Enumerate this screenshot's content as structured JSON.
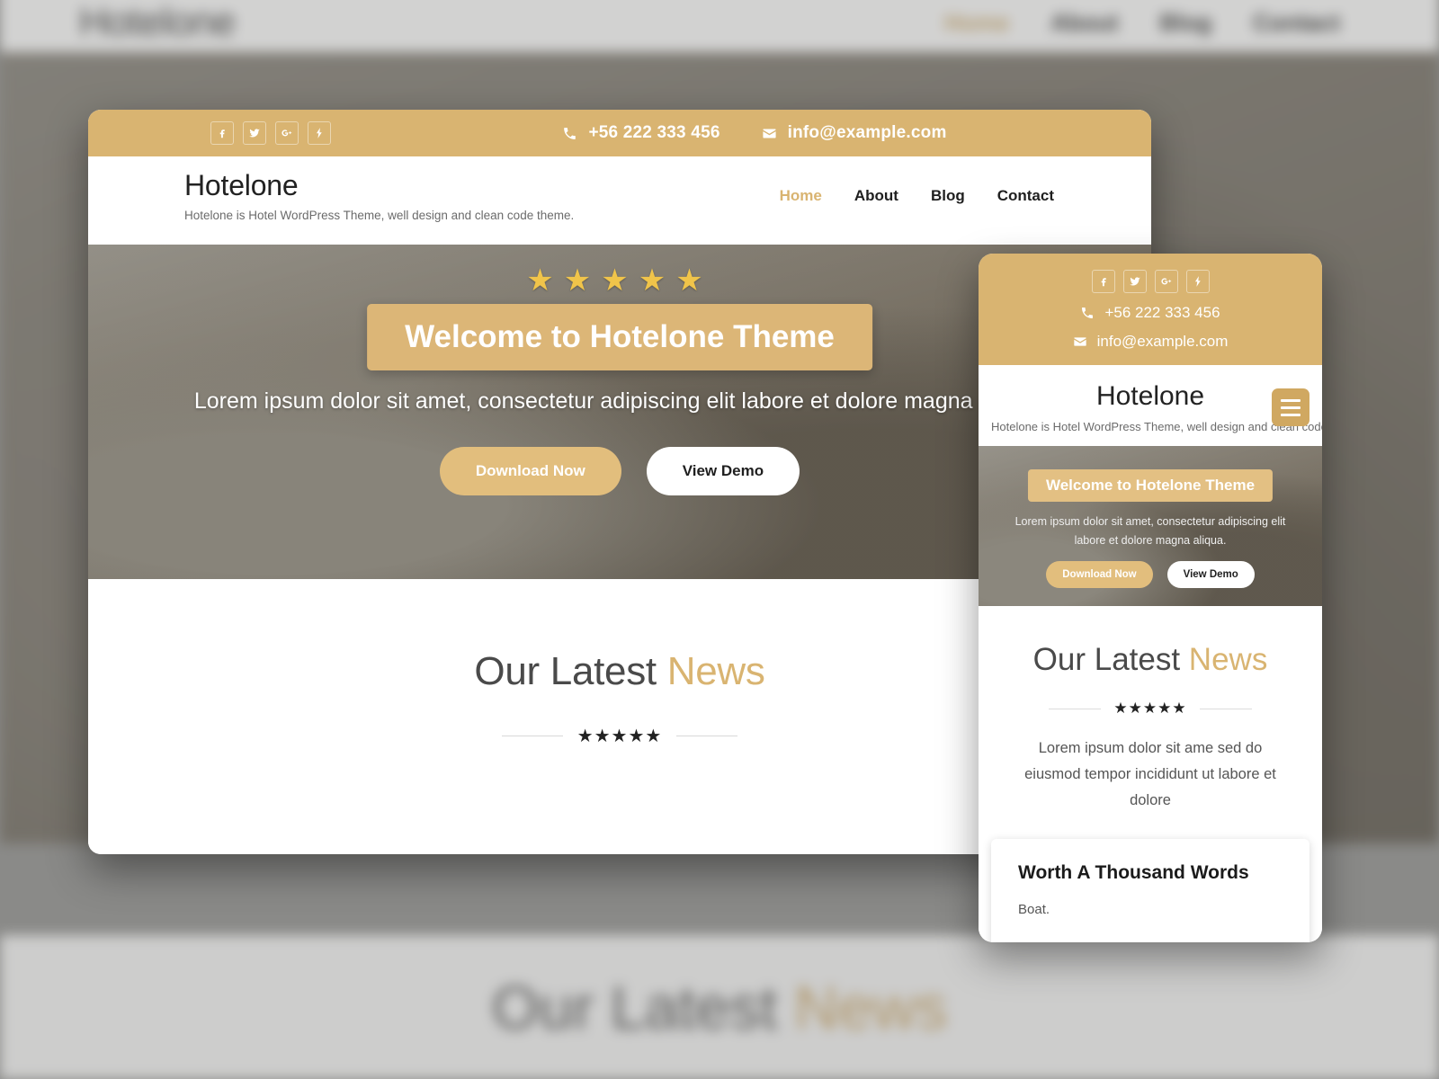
{
  "brand": {
    "name": "Hotelone",
    "tagline": "Hotelone is Hotel WordPress Theme, well design and clean code theme."
  },
  "colors": {
    "gold": "#d9b471",
    "gold_button": "#e2be7d",
    "heading_gray": "#4a4a4a",
    "page_backdrop": "#8a8a88"
  },
  "topbar": {
    "socials": [
      {
        "name": "facebook-icon",
        "glyph": "f"
      },
      {
        "name": "twitter-icon",
        "glyph": "t"
      },
      {
        "name": "google-plus-icon",
        "glyph": "g+"
      },
      {
        "name": "flash-icon",
        "glyph": "s"
      }
    ],
    "phone": "+56 222 333 456",
    "email": "info@example.com",
    "phone_icon": "phone-icon",
    "email_icon": "envelope-icon"
  },
  "nav": {
    "items": [
      {
        "label": "Home",
        "active": true
      },
      {
        "label": "About",
        "active": false
      },
      {
        "label": "Blog",
        "active": false
      },
      {
        "label": "Contact",
        "active": false
      }
    ]
  },
  "hero": {
    "stars": "★★★★★",
    "banner_title": "Welcome to Hotelone Theme",
    "subtitle": "Lorem ipsum dolor sit amet, consectetur adipiscing elit labore et dolore magna aliqua.",
    "mobile_subtitle": "Lorem ipsum dolor sit amet, consectetur adipiscing elit labore et dolore magna aliqua.",
    "primary_button": "Download Now",
    "secondary_button": "View Demo"
  },
  "news": {
    "title_plain": "Our Latest ",
    "title_accent": "News",
    "separator_stars": "★★★★★",
    "description": "Lorem ipsum dolor sit ame sed do eiusmod tempor incididunt ut labore et dolore",
    "card": {
      "title": "Worth A Thousand Words",
      "excerpt": "Boat."
    }
  },
  "mobile": {
    "menu_button": "hamburger-menu"
  },
  "background": {
    "brand": "Hotelone",
    "tagline": "Hotelone is Hotel WordPress Theme, well design and clean code theme.",
    "nav": [
      "Home",
      "About",
      "Blog",
      "Contact"
    ],
    "news_plain": "Our Latest ",
    "news_accent": "News"
  }
}
